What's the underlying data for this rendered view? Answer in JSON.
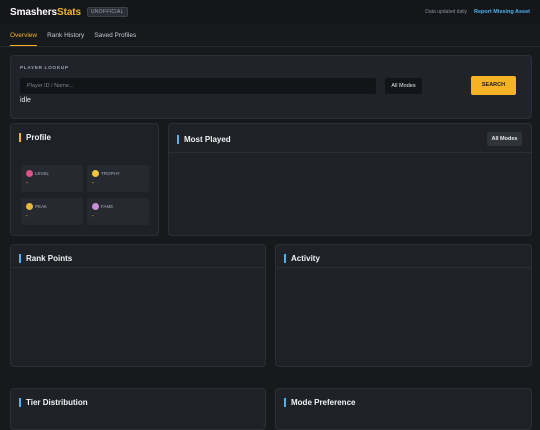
{
  "header": {
    "brand_part1": "Smashers",
    "brand_part2": "Stats",
    "badge": "UNOFFICIAL",
    "updated_text": "Data updated daily",
    "report_link": "Report Missing Asset"
  },
  "tabs": [
    {
      "label": "Overview",
      "active": true
    },
    {
      "label": "Rank History",
      "active": false
    },
    {
      "label": "Saved Profiles",
      "active": false
    }
  ],
  "lookup": {
    "section_label": "PLAYER LOOKUP",
    "input_placeholder": "Player ID / Name...",
    "mode_select": "All Modes",
    "search_button": "SEARCH",
    "status": "idle"
  },
  "profile": {
    "title": "Profile",
    "stats": [
      {
        "label": "LEVEL",
        "value": "-",
        "icon": "level-icon"
      },
      {
        "label": "TROPHY",
        "value": "-",
        "icon": "trophy-icon"
      },
      {
        "label": "PEAK",
        "value": "-",
        "icon": "peak-icon"
      },
      {
        "label": "FAME",
        "value": "-",
        "icon": "fame-icon"
      }
    ]
  },
  "most_played": {
    "title": "Most Played",
    "mode_button": "All Modes"
  },
  "panels": {
    "rank_points": "Rank Points",
    "activity": "Activity",
    "tier_distribution": "Tier Distribution",
    "mode_preference": "Mode Preference"
  },
  "colors": {
    "accent_gold": "#f5b324",
    "accent_blue": "#4fb3f0",
    "background": "#17191d"
  }
}
